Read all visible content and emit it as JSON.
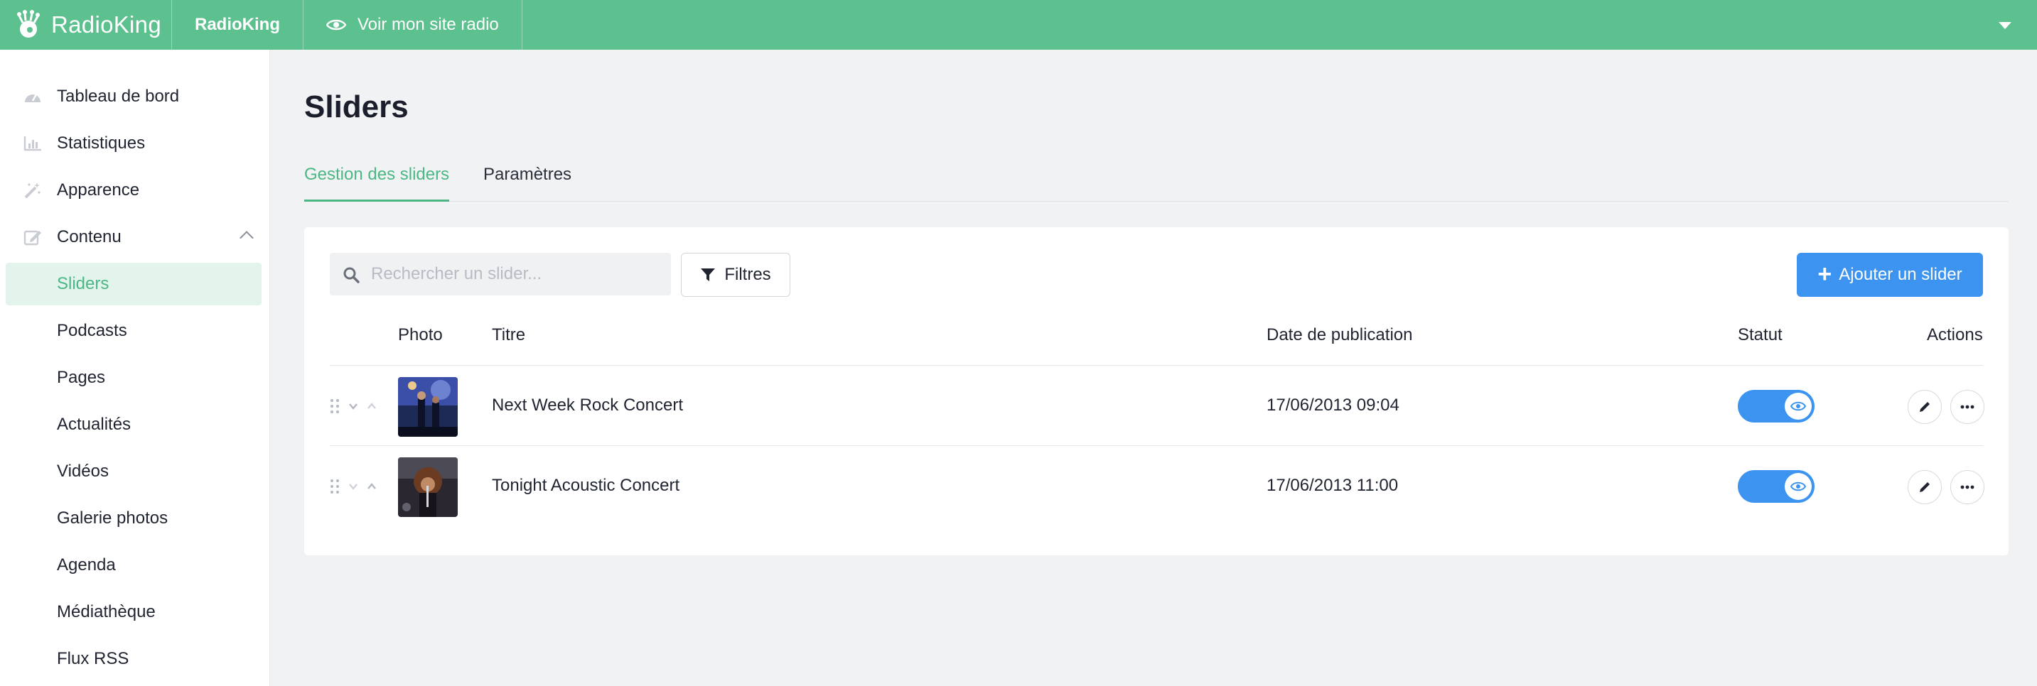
{
  "topbar": {
    "brand": "RadioKing",
    "radio_name": "RadioKing",
    "view_site_label": "Voir mon site radio"
  },
  "sidebar": {
    "items": [
      {
        "label": "Tableau de bord",
        "icon": "dashboard-icon"
      },
      {
        "label": "Statistiques",
        "icon": "bar-chart-icon"
      },
      {
        "label": "Apparence",
        "icon": "magic-wand-icon"
      },
      {
        "label": "Contenu",
        "icon": "edit-icon",
        "expanded": true
      },
      {
        "label": "Sliders",
        "active": true
      },
      {
        "label": "Podcasts"
      },
      {
        "label": "Pages"
      },
      {
        "label": "Actualités"
      },
      {
        "label": "Vidéos"
      },
      {
        "label": "Galerie photos"
      },
      {
        "label": "Agenda"
      },
      {
        "label": "Médiathèque"
      },
      {
        "label": "Flux RSS"
      }
    ]
  },
  "main": {
    "title": "Sliders",
    "tabs": [
      {
        "label": "Gestion des sliders",
        "active": true
      },
      {
        "label": "Paramètres",
        "active": false
      }
    ],
    "search": {
      "placeholder": "Rechercher un slider..."
    },
    "filter_label": "Filtres",
    "add_label": "Ajouter un slider",
    "table": {
      "headers": {
        "photo": "Photo",
        "title": "Titre",
        "date": "Date de publication",
        "status": "Statut",
        "actions": "Actions"
      },
      "rows": [
        {
          "title": "Next Week Rock Concert",
          "date": "17/06/2013 09:04",
          "status_on": true
        },
        {
          "title": "Tonight Acoustic Concert",
          "date": "17/06/2013 11:00",
          "status_on": true
        }
      ]
    }
  },
  "colors": {
    "brand_green": "#5cc08f",
    "accent_green": "#4cb784",
    "primary_blue": "#3d94f0"
  }
}
